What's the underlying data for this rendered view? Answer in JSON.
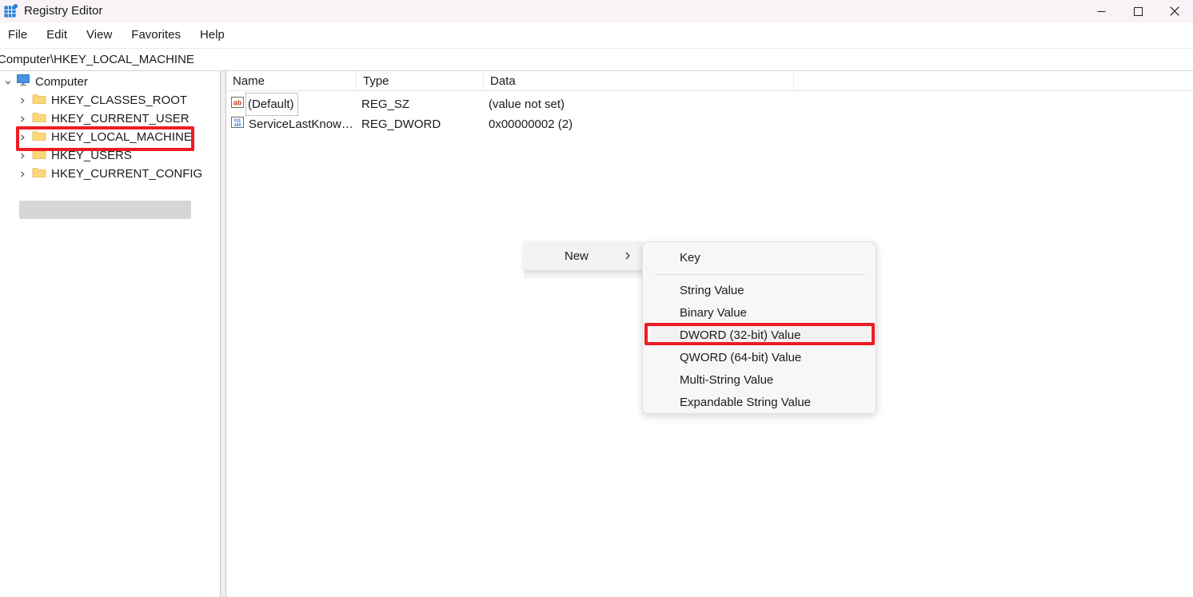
{
  "window": {
    "title": "Registry Editor",
    "app_icon": "registry-editor-icon",
    "controls": {
      "minimize": "—",
      "maximize": "☐",
      "close": "✕"
    }
  },
  "menubar": {
    "items": [
      {
        "label": "File"
      },
      {
        "label": "Edit"
      },
      {
        "label": "View"
      },
      {
        "label": "Favorites"
      },
      {
        "label": "Help"
      }
    ]
  },
  "address": {
    "path": "Computer\\HKEY_LOCAL_MACHINE"
  },
  "tree": {
    "root": {
      "label": "Computer",
      "icon": "monitor-icon",
      "expanded": true
    },
    "items": [
      {
        "label": "HKEY_CLASSES_ROOT",
        "icon": "folder-icon",
        "selected": false
      },
      {
        "label": "HKEY_CURRENT_USER",
        "icon": "folder-icon",
        "selected": false
      },
      {
        "label": "HKEY_LOCAL_MACHINE",
        "icon": "folder-icon",
        "selected": true
      },
      {
        "label": "HKEY_USERS",
        "icon": "folder-icon",
        "selected": false
      },
      {
        "label": "HKEY_CURRENT_CONFIG",
        "icon": "folder-icon",
        "selected": false
      }
    ]
  },
  "list": {
    "columns": [
      {
        "label": "Name"
      },
      {
        "label": "Type"
      },
      {
        "label": "Data"
      }
    ],
    "rows": [
      {
        "name": "(Default)",
        "type": "REG_SZ",
        "data": "(value not set)",
        "icon": "string-value-icon",
        "focused": true
      },
      {
        "name": "ServiceLastKnow…",
        "type": "REG_DWORD",
        "data": "0x00000002 (2)",
        "icon": "dword-value-icon",
        "focused": false
      }
    ]
  },
  "context_menu": {
    "parent": {
      "label": "New",
      "chevron": "chevron-right-icon",
      "highlighted": true
    },
    "submenu": [
      {
        "label": "Key",
        "highlighted": false
      },
      {
        "label": "String Value",
        "highlighted": false
      },
      {
        "label": "Binary Value",
        "highlighted": false
      },
      {
        "label": "DWORD (32-bit) Value",
        "highlighted": true
      },
      {
        "label": "QWORD (64-bit) Value",
        "highlighted": false
      },
      {
        "label": "Multi-String Value",
        "highlighted": false
      },
      {
        "label": "Expandable String Value",
        "highlighted": false
      }
    ]
  },
  "annotations": {
    "highlight_color": "#ee1c25",
    "targets": [
      "HKEY_LOCAL_MACHINE",
      "DWORD (32-bit) Value"
    ]
  }
}
